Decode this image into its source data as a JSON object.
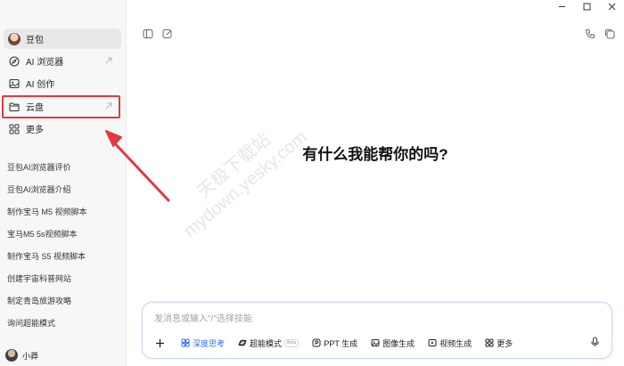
{
  "sidebar": {
    "nav": [
      {
        "label": "豆包",
        "icon": "doubao-avatar-icon"
      },
      {
        "label": "AI 浏览器",
        "icon": "compass-icon",
        "arrow": true
      },
      {
        "label": "AI 创作",
        "icon": "image-icon"
      },
      {
        "label": "云盘",
        "icon": "folder-icon",
        "arrow": true
      },
      {
        "label": "更多",
        "icon": "grid-icon"
      }
    ],
    "history": [
      "豆包AI浏览器评价",
      "豆包AI浏览器介绍",
      "制作宝马 M5 视频脚本",
      "宝马M5 5s视频脚本",
      "制作宝马 S5 视频脚本",
      "创建宇宙科普网站",
      "制定青岛旅游攻略",
      "询问超能模式"
    ],
    "user": {
      "name": "小莽"
    }
  },
  "main": {
    "greeting": "有什么我能帮你的吗?",
    "input": {
      "placeholder": "发消息或输入\"/\"选择技能"
    },
    "tools": [
      {
        "label": "深度思考",
        "icon": "deep-think-icon",
        "active": true
      },
      {
        "label": "超能模式",
        "icon": "super-mode-icon",
        "badge": "Beta"
      },
      {
        "label": "PPT 生成",
        "icon": "ppt-icon"
      },
      {
        "label": "图像生成",
        "icon": "image-gen-icon"
      },
      {
        "label": "视频生成",
        "icon": "video-icon"
      },
      {
        "label": "更多",
        "icon": "more-grid-icon"
      }
    ]
  },
  "watermark": {
    "line1": "天极下载站",
    "line2": "mydown.yesky.com"
  },
  "colors": {
    "accent": "#3370ff",
    "annotation": "#e0393e",
    "sidebar_bg": "#f7f7f8"
  }
}
